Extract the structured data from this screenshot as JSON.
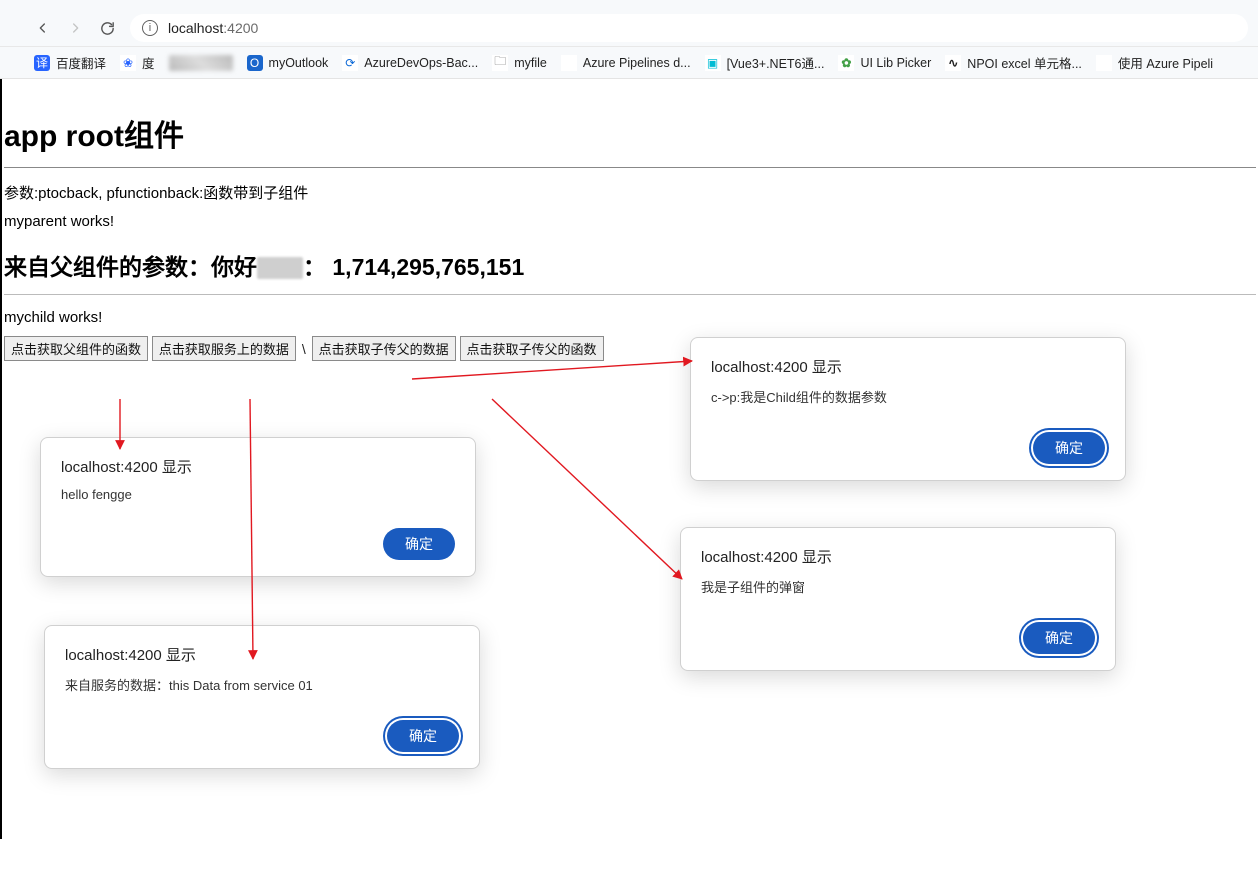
{
  "browser": {
    "address": {
      "host": "localhost",
      "port": ":4200"
    },
    "bookmarks": [
      {
        "icon": "blue",
        "glyph": "译",
        "label": "百度翻译"
      },
      {
        "icon": "paw",
        "glyph": "❀",
        "label": "度"
      },
      {
        "icon": "px",
        "glyph": "",
        "label": ""
      },
      {
        "icon": "out",
        "glyph": "O",
        "label": "myOutlook"
      },
      {
        "icon": "adev",
        "glyph": "⟳",
        "label": "AzureDevOps-Bac..."
      },
      {
        "icon": "folder",
        "glyph": "🗀",
        "label": "myfile"
      },
      {
        "icon": "grid",
        "glyph": "",
        "label": "Azure Pipelines d..."
      },
      {
        "icon": "tv",
        "glyph": "▣",
        "label": "[Vue3+.NET6通..."
      },
      {
        "icon": "green",
        "glyph": "✿",
        "label": "UI Lib Picker"
      },
      {
        "icon": "swirl",
        "glyph": "∿",
        "label": "NPOI excel 单元格..."
      },
      {
        "icon": "grid",
        "glyph": "",
        "label": "使用 Azure Pipeli"
      }
    ]
  },
  "page": {
    "app_title": "app root组件",
    "params_line": "参数:ptocback, pfunctionback:函数带到子组件",
    "parent_works": "myparent works!",
    "param_heading_prefix": "来自父组件的参数：你好",
    "param_heading_sep": "：",
    "param_heading_number": "1,714,295,765,151",
    "child_works": "mychild works!",
    "buttons": {
      "get_parent_fn": "点击获取父组件的函数",
      "get_service_data": "点击获取服务上的数据",
      "get_child_to_parent_data": "点击获取子传父的数据",
      "get_child_to_parent_fn": "点击获取子传父的函数"
    }
  },
  "dialogs": {
    "title": "localhost:4200 显示",
    "ok": "确定",
    "d1_msg": "hello fengge",
    "d2_msg": "来自服务的数据：this Data from service 01",
    "d3_msg": "c->p:我是Child组件的数据参数",
    "d4_msg": "我是子组件的弹窗"
  }
}
